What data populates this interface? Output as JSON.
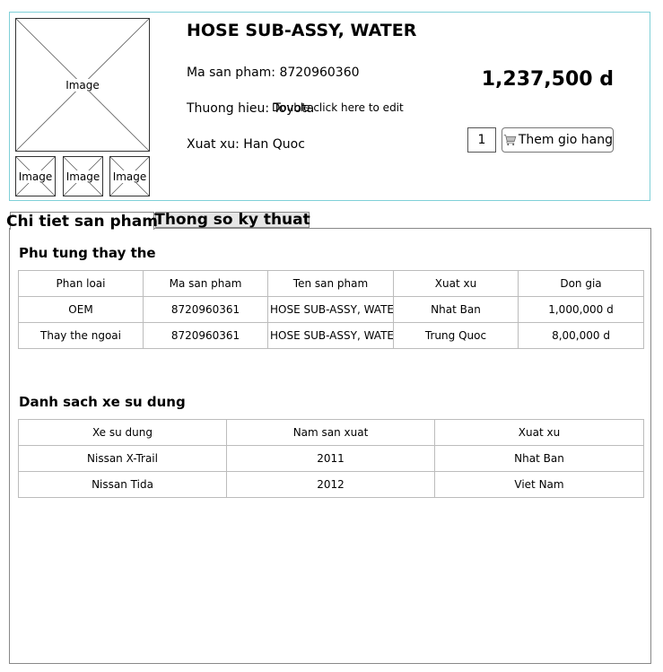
{
  "product": {
    "title": "HOSE SUB-ASSY, WATER",
    "code_line": "Ma san pham: 8720960360",
    "brand_line": "Thuong hieu: Toyota",
    "origin_line": "Xuat xu: Han Quoc",
    "edit_hint": "Double click here to edit",
    "price": "1,237,500 d",
    "quantity": "1",
    "add_to_cart_label": "Them gio hang",
    "main_image_label": "Image",
    "thumbnails": [
      "Image",
      "Image",
      "Image"
    ]
  },
  "tabs": [
    {
      "label": "Chi tiet san pham",
      "active": true
    },
    {
      "label": "Thong so ky thuat",
      "active": false
    }
  ],
  "replacement_parts": {
    "title": "Phu tung thay the",
    "headers": [
      "Phan loai",
      "Ma san pham",
      "Ten san pham",
      "Xuat xu",
      "Don gia"
    ],
    "rows": [
      [
        "OEM",
        "8720960361",
        "HOSE SUB-ASSY, WATER",
        "Nhat Ban",
        "1,000,000 d"
      ],
      [
        "Thay the ngoai",
        "8720960361",
        "HOSE SUB-ASSY, WATER",
        "Trung Quoc",
        "8,00,000 d"
      ]
    ]
  },
  "vehicles": {
    "title": "Danh sach xe su dung",
    "headers": [
      "Xe su dung",
      "Nam san xuat",
      "Xuat xu"
    ],
    "rows": [
      [
        "Nissan X-Trail",
        "2011",
        "Nhat Ban"
      ],
      [
        "Nissan Tida",
        "2012",
        "Viet Nam"
      ]
    ]
  },
  "colors": {
    "panel_border": "#7fd0d8",
    "inactive_tab_bg": "#e6e6e6"
  }
}
